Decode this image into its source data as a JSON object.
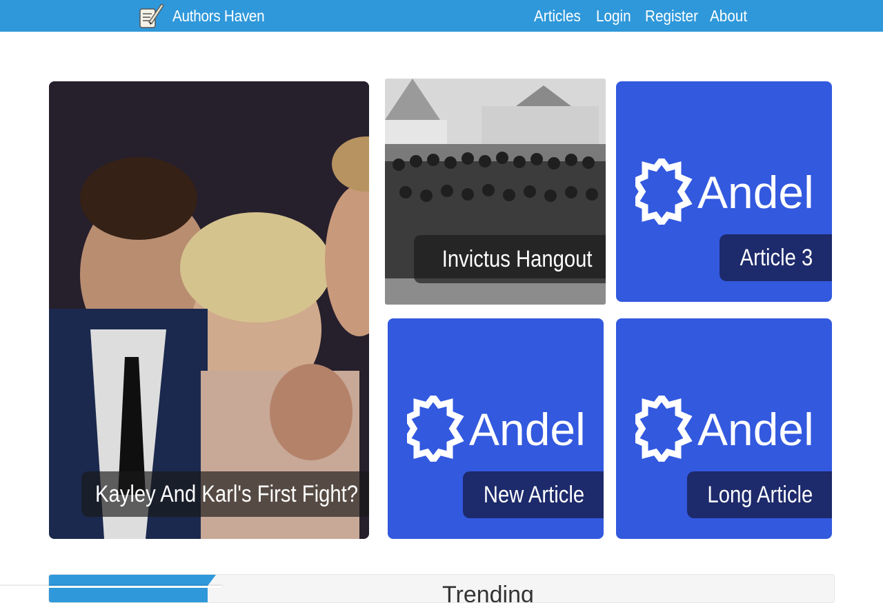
{
  "navbar": {
    "brand_name": "Authors Haven",
    "links": [
      "Articles",
      "Login",
      "Register",
      "About"
    ]
  },
  "articles": [
    {
      "title": "Kayley And Karl's First Fight?",
      "image": "photo"
    },
    {
      "title": "Invictus Hangout",
      "image": "photo"
    },
    {
      "title": "Article 3",
      "image": "andela-logo"
    },
    {
      "title": "New Article",
      "image": "andela-logo"
    },
    {
      "title": "Long Article",
      "image": "andela-logo"
    }
  ],
  "andela_logo_text": "Andela",
  "trending": {
    "title": "Trending"
  },
  "colors": {
    "navbar": "#2f98da",
    "andela_blue": "#3359df",
    "caption_navy": "#1d2a6b"
  }
}
